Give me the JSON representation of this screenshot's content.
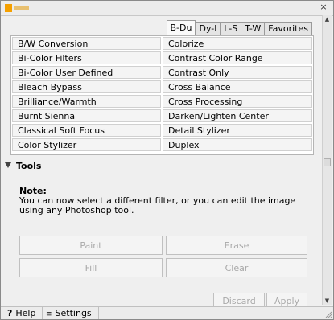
{
  "tabs": [
    {
      "label": "B-Du",
      "active": true
    },
    {
      "label": "Dy-l",
      "active": false
    },
    {
      "label": "L-S",
      "active": false
    },
    {
      "label": "T-W",
      "active": false
    },
    {
      "label": "Favorites",
      "active": false
    }
  ],
  "filters": [
    [
      "B/W Conversion",
      "Colorize"
    ],
    [
      "Bi-Color Filters",
      "Contrast Color Range"
    ],
    [
      "Bi-Color User Defined",
      "Contrast Only"
    ],
    [
      "Bleach Bypass",
      "Cross Balance"
    ],
    [
      "Brilliance/Warmth",
      "Cross Processing"
    ],
    [
      "Burnt Sienna",
      "Darken/Lighten Center"
    ],
    [
      "Classical Soft Focus",
      "Detail Stylizer"
    ],
    [
      "Color Stylizer",
      "Duplex"
    ]
  ],
  "tools": {
    "header": "Tools",
    "note_title": "Note:",
    "note_text": "You can now select a different filter, or you can edit the image using any Photoshop tool.",
    "paint": "Paint",
    "erase": "Erase",
    "fill": "Fill",
    "clear": "Clear",
    "discard": "Discard",
    "apply": "Apply"
  },
  "bottom": {
    "help": "Help",
    "help_icon": "?",
    "settings": "Settings",
    "settings_icon": "≡"
  },
  "title_close": "×"
}
